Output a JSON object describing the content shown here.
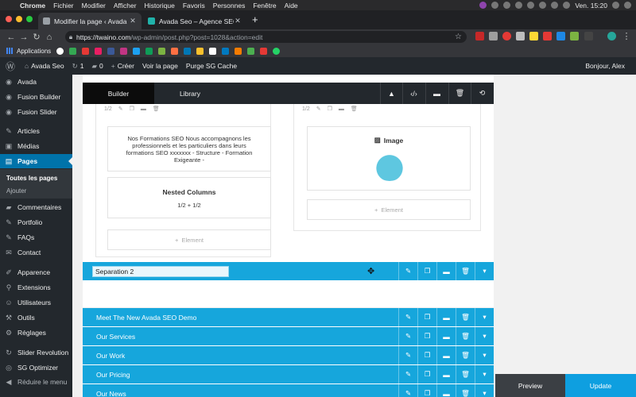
{
  "menubar": {
    "app": "Chrome",
    "items": [
      "Fichier",
      "Modifier",
      "Afficher",
      "Historique",
      "Favoris",
      "Personnes",
      "Fenêtre",
      "Aide"
    ],
    "clock": "Ven. 15:20"
  },
  "tabs": [
    {
      "label": "Modifier la page ‹ Avada Seo –"
    },
    {
      "label": "Avada Seo – Agence SEO"
    }
  ],
  "address": {
    "host": "https://twaino.com",
    "path": "/wp-admin/post.php?post=1028&action=edit"
  },
  "bookmarks": {
    "apps_label": "Applications"
  },
  "wpbar": {
    "site": "Avada Seo",
    "updates": "1",
    "comments": "0",
    "new": "Créer",
    "view": "Voir la page",
    "purge": "Purge SG Cache",
    "greeting": "Bonjour, Alex"
  },
  "sidebar": {
    "items": [
      {
        "label": "Avada",
        "icon": "avada-icon"
      },
      {
        "label": "Fusion Builder",
        "icon": "fusion-builder-icon"
      },
      {
        "label": "Fusion Slider",
        "icon": "fusion-slider-icon"
      },
      {
        "label": "Articles",
        "icon": "pin-icon"
      },
      {
        "label": "Médias",
        "icon": "media-icon"
      },
      {
        "label": "Pages",
        "icon": "pages-icon"
      },
      {
        "label": "Commentaires",
        "icon": "comment-icon"
      },
      {
        "label": "Portfolio",
        "icon": "pin-icon"
      },
      {
        "label": "FAQs",
        "icon": "pin-icon"
      },
      {
        "label": "Contact",
        "icon": "contact-icon"
      },
      {
        "label": "Apparence",
        "icon": "brush-icon"
      },
      {
        "label": "Extensions",
        "icon": "plugin-icon"
      },
      {
        "label": "Utilisateurs",
        "icon": "users-icon"
      },
      {
        "label": "Outils",
        "icon": "wrench-icon"
      },
      {
        "label": "Réglages",
        "icon": "settings-icon"
      },
      {
        "label": "Slider Revolution",
        "icon": "slider-icon"
      },
      {
        "label": "SG Optimizer",
        "icon": "sg-icon"
      },
      {
        "label": "Réduire le menu",
        "icon": "collapse-icon"
      }
    ],
    "submenu": [
      "Toutes les pages",
      "Ajouter"
    ]
  },
  "builder": {
    "tab_builder": "Builder",
    "tab_library": "Library"
  },
  "columns": {
    "left": {
      "tools": "1/2",
      "text": "Nos Formations SEO Nous accompagnons les professionnels et les particuliers dans leurs formations SEO xxxxxxx - Structure - Formation Exigeante -",
      "nested_title": "Nested Columns",
      "nested_sub": "1/2 + 1/2",
      "add_element": "Element"
    },
    "right": {
      "tools": "1/2",
      "image_title": "Image",
      "add_element": "Element"
    }
  },
  "containers": [
    {
      "name": "Separation 2"
    },
    {
      "name": "Meet The New Avada SEO Demo"
    },
    {
      "name": "Our Services"
    },
    {
      "name": "Our Work"
    },
    {
      "name": "Our Pricing"
    },
    {
      "name": "Our News"
    }
  ],
  "actions": {
    "preview": "Preview",
    "update": "Update"
  },
  "colors": {
    "accent": "#16a6dc",
    "admin_dark": "#23282d",
    "wp_active": "#0073aa"
  }
}
